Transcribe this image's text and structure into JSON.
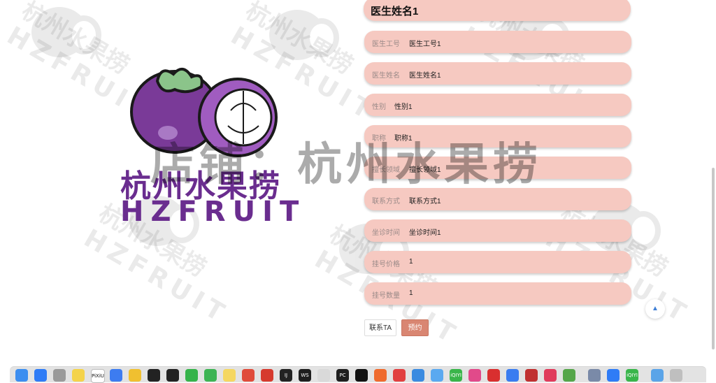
{
  "doctor_title": "医生姓名1",
  "watermark": "店铺：杭州水果捞",
  "brand": {
    "name_cn": "杭州水果捞",
    "name_en": "HZFRUIT"
  },
  "fields": [
    {
      "label": "医生工号",
      "value": "医生工号1"
    },
    {
      "label": "医生姓名",
      "value": "医生姓名1"
    },
    {
      "label": "性别",
      "value": "性别1"
    },
    {
      "label": "职称",
      "value": "职称1"
    },
    {
      "label": "擅长领域",
      "value": "擅长领域1"
    },
    {
      "label": "联系方式",
      "value": "联系方式1"
    },
    {
      "label": "坐诊时间",
      "value": "坐诊时间1"
    },
    {
      "label": "挂号价格",
      "value": "1"
    },
    {
      "label": "挂号数量",
      "value": "1"
    }
  ],
  "buttons": {
    "contact": "联系TA",
    "book": "预约"
  },
  "back_to_top_icon": "arrow-up-icon",
  "dock": {
    "apps": [
      {
        "name": "finder-icon",
        "color": "#3c8ef0"
      },
      {
        "name": "app-store-icon",
        "color": "#2f7cf6"
      },
      {
        "name": "launchpad-icon",
        "color": "#9a9a9a"
      },
      {
        "name": "notes-icon",
        "color": "#f4d34a"
      },
      {
        "name": "pixiu-icon",
        "color": "#ffffff",
        "text": "PiXiU"
      },
      {
        "name": "dingtalk-icon",
        "color": "#3d7cf0"
      },
      {
        "name": "app-yellow-icon",
        "color": "#f0c030"
      },
      {
        "name": "qq-icon",
        "color": "#222222"
      },
      {
        "name": "qq-2-icon",
        "color": "#222222"
      },
      {
        "name": "wechat-icon",
        "color": "#35b34a"
      },
      {
        "name": "wechat-2-icon",
        "color": "#3db454"
      },
      {
        "name": "app-face-icon",
        "color": "#f5d760"
      },
      {
        "name": "chrome-icon",
        "color": "#e04b3a"
      },
      {
        "name": "wps-icon",
        "color": "#d63a2e"
      },
      {
        "name": "intellij-icon",
        "color": "#222222",
        "text": "IJ"
      },
      {
        "name": "webstorm-icon",
        "color": "#1e1e1e",
        "text": "WS"
      },
      {
        "name": "app-gray-icon",
        "color": "#d9d9d9"
      },
      {
        "name": "pycharm-icon",
        "color": "#1e1e1e",
        "text": "PC"
      },
      {
        "name": "terminal-icon",
        "color": "#111111"
      },
      {
        "name": "app-orange-icon",
        "color": "#ef6a2d"
      },
      {
        "name": "app-red-icon",
        "color": "#e14040"
      },
      {
        "name": "app-blue-icon",
        "color": "#3b8be0"
      },
      {
        "name": "app-lightblue-icon",
        "color": "#5aa9f0"
      },
      {
        "name": "iqiyi-icon",
        "color": "#39b54a",
        "text": "iQIYI"
      },
      {
        "name": "app-pink-icon",
        "color": "#e14a8a"
      },
      {
        "name": "netease-music-icon",
        "color": "#d92f2f"
      },
      {
        "name": "app-cyan-icon",
        "color": "#3a7cf0"
      },
      {
        "name": "app-darkred-icon",
        "color": "#c03030"
      },
      {
        "name": "app-rose-icon",
        "color": "#e03b5b"
      },
      {
        "name": "app-leaf-icon",
        "color": "#55a64a"
      },
      {
        "name": "preview-icon",
        "color": "#7a8aa8"
      },
      {
        "name": "app-arrow-icon",
        "color": "#2f7cf6"
      },
      {
        "name": "iqiyi-2-icon",
        "color": "#39b54a",
        "text": "iQIYI"
      },
      {
        "name": "folder-icon",
        "color": "#5aa4e8"
      },
      {
        "name": "trash-icon",
        "color": "#bfbfbf"
      }
    ]
  }
}
